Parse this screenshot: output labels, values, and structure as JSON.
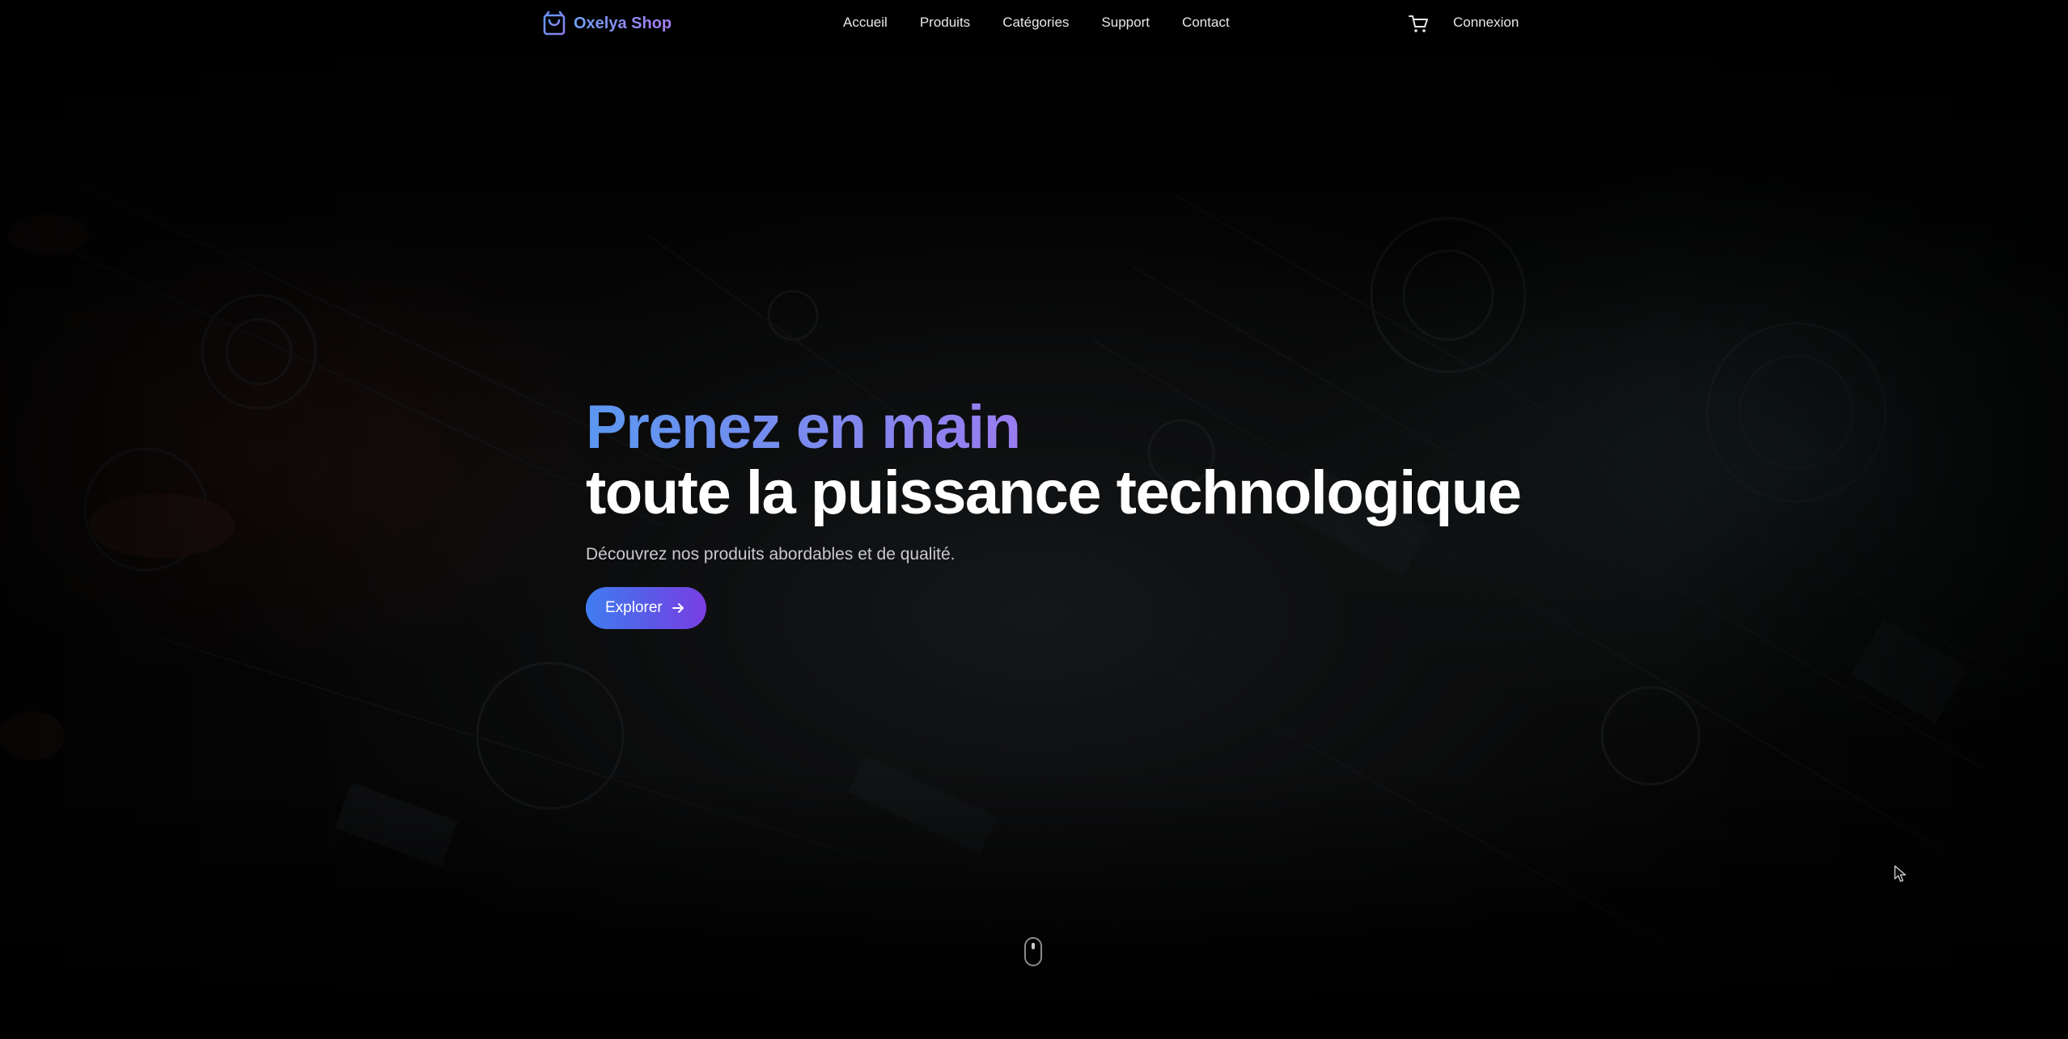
{
  "header": {
    "brand": {
      "name": "Oxelya Shop",
      "icon": "shopping-bag-icon"
    },
    "nav": [
      {
        "label": "Accueil"
      },
      {
        "label": "Produits"
      },
      {
        "label": "Catégories"
      },
      {
        "label": "Support"
      },
      {
        "label": "Contact"
      }
    ],
    "cart_icon": "cart-icon",
    "login_label": "Connexion"
  },
  "hero": {
    "title_highlight": "Prenez en main",
    "title_rest": "toute la puissance technologique",
    "subtitle": "Découvrez nos produits abordables et de qualité.",
    "cta_label": "Explorer",
    "cta_icon": "arrow-right-icon"
  },
  "scroll_indicator_icon": "mouse-scroll-icon",
  "colors": {
    "background": "#000000",
    "accent_blue": "#3f7df1",
    "accent_purple": "#7a3fe2",
    "text": "#ffffff"
  }
}
